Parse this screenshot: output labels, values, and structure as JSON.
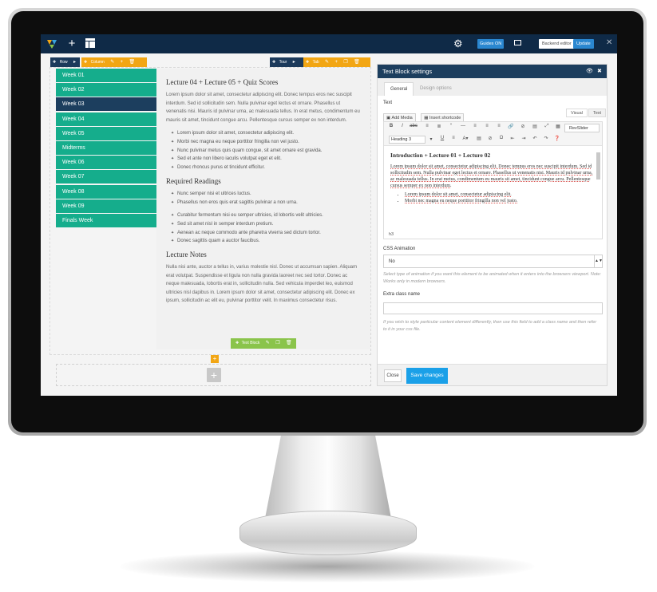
{
  "topbar": {
    "guides_label": "Guides ON",
    "backend_label": "Backend editor",
    "update_label": "Update",
    "close_glyph": "✕",
    "add_glyph": "+",
    "colors": {
      "bar": "#0f2a47",
      "accent": "#2a87d0"
    }
  },
  "editor_toolbars": {
    "row_label": "Row",
    "column_label": "Column",
    "tour_label": "Tour",
    "tab_label": "Tab",
    "textblock_label": "Text Block"
  },
  "tabs": [
    {
      "label": "Week 01",
      "active": false
    },
    {
      "label": "Week 02",
      "active": false
    },
    {
      "label": "Week 03",
      "active": true
    },
    {
      "label": "Week 04",
      "active": false
    },
    {
      "label": "Week 05",
      "active": false
    },
    {
      "label": "Midterms",
      "active": false
    },
    {
      "label": "Week 06",
      "active": false
    },
    {
      "label": "Week 07",
      "active": false
    },
    {
      "label": "Week 08",
      "active": false
    },
    {
      "label": "Week 09",
      "active": false
    },
    {
      "label": "Finals Week",
      "active": false
    }
  ],
  "content": {
    "heading1": "Lecture 04 + Lecture 05 + Quiz Scores",
    "para1": "Lorem ipsum dolor sit amet, consectetur adipiscing elit. Donec tempus eros nec suscipit interdum. Sed id sollicitudin sem. Nulla pulvinar eget lectus et ornare. Phasellus ut venenatis nisi. Mauris id pulvinar urna, ac malesuada tellus. In erat metus, condimentum eu mauris sit amet, tincidunt congue arcu. Pellentesque cursus semper ex non interdum.",
    "list1": [
      "Lorem ipsum dolor sit amet, consectetur adipiscing elit.",
      "Morbi nec magna eu neque porttitor fringilla non vel justo.",
      "Nunc pulvinar metus quis quam congue, sit amet ornare est gravida.",
      "Sed et ante non libero iaculis volutpat eget et elit.",
      "Donec rhoncus purus et tincidunt efficitur."
    ],
    "heading2": "Required Readings",
    "list2": [
      "Nunc semper nisi et ultrices luctus.",
      "Phasellus non eros quis erat sagittis pulvinar a non urna."
    ],
    "list3": [
      "Curabitur fermentum nisi eu semper ultricies, id lobortis velit ultricies.",
      "Sed sit amet nisl in semper interdum pretium.",
      "Aenean ac neque commodo ante pharetra viverra sed dictum tortor.",
      "Donec sagittis quam a auctor faucibus."
    ],
    "heading3": "Lecture Notes",
    "para2": "Nulla nisi ante, auctor a tellus in, varius molestie nisl. Donec ut accumsan sapien. Aliquam erat volutpat. Suspendisse et ligula non nulla gravida laoreet nec sed tortor. Donec ac neque malesuada, lobortis erat in, sollicitudin nulla. Sed vehicula imperdiet leo, euismod ultricies nisl dapibus in. Lorem ipsum dolor sit amet, consectetur adipiscing elit. Donec ex ipsum, sollicitudin ac elit eu, pulvinar porttitor velit. In maximus consectetur risus."
  },
  "settings": {
    "title": "Text Block settings",
    "tab_general": "General",
    "tab_design": "Design options",
    "text_label": "Text",
    "add_media": "Add Media",
    "insert_shortcode": "Insert shortcode",
    "visual_tab": "Visual",
    "text_tab": "Text",
    "format_select": "Heading 3",
    "revslider": "RevSlider",
    "editor_heading": "Introduction + Lecture 01 + Lecture 02",
    "editor_para": "Lorem ipsum dolor sit amet, consectetur adipiscing elit. Donec tempus eros nec suscipit interdum. Sed id sollicitudin sem. Nulla pulvinar eget lectus et ornare. Phasellus ut venenatis nisi. Mauris id pulvinar urna, ac malesuada tellus. In erat metus, condimentum eu mauris sit amet, tincidunt congue arcu. Pellentesque cursus semper ex non interdum.",
    "editor_list": [
      "Lorem ipsum dolor sit amet, consectetur adipiscing elit.",
      "Morbi nec magna eu neque porttitor fringilla non vel justo."
    ],
    "editor_path": "h3",
    "css_animation_label": "CSS Animation",
    "css_animation_value": "No",
    "css_animation_help": "Select type of animation if you want this element to be animated when it enters into the browsers viewport. Note: Works only in modern browsers.",
    "extra_class_label": "Extra class name",
    "extra_class_value": "",
    "extra_class_help": "If you wish to style particular content element differently, then use this field to add a class name and then refer to it in your css file.",
    "close_button": "Close",
    "save_button": "Save changes",
    "colors": {
      "header": "#1c3e5e",
      "save": "#1aa0e8"
    }
  }
}
